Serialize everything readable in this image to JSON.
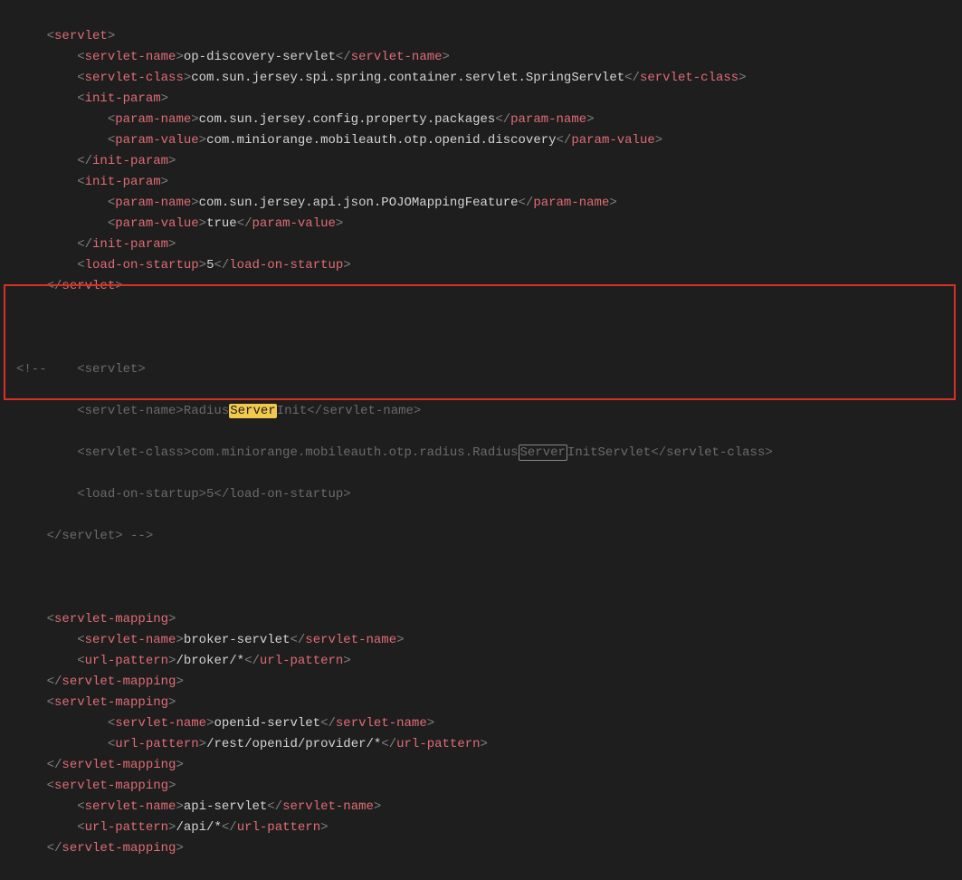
{
  "code": {
    "lines": [
      {
        "indent": 2,
        "open": "servlet"
      },
      {
        "indent": 4,
        "open": "servlet-name",
        "text": "op-discovery-servlet",
        "close": "servlet-name"
      },
      {
        "indent": 4,
        "open": "servlet-class",
        "text": "com.sun.jersey.spi.spring.container.servlet.SpringServlet",
        "close": "servlet-class"
      },
      {
        "indent": 4,
        "open": "init-param"
      },
      {
        "indent": 6,
        "open": "param-name",
        "text": "com.sun.jersey.config.property.packages",
        "close": "param-name"
      },
      {
        "indent": 6,
        "open": "param-value",
        "text": "com.miniorange.mobileauth.otp.openid.discovery",
        "close": "param-value"
      },
      {
        "indent": 4,
        "closeTag": "init-param"
      },
      {
        "indent": 4,
        "open": "init-param"
      },
      {
        "indent": 6,
        "open": "param-name",
        "text": "com.sun.jersey.api.json.POJOMappingFeature",
        "close": "param-name"
      },
      {
        "indent": 6,
        "open": "param-value",
        "text": "true",
        "close": "param-value"
      },
      {
        "indent": 4,
        "closeTag": "init-param"
      },
      {
        "indent": 4,
        "open": "load-on-startup",
        "text": "5",
        "close": "load-on-startup"
      },
      {
        "indent": 2,
        "closeTag": "servlet"
      }
    ],
    "comment": {
      "l1_pre": "<!--    <servlet>",
      "l2_pre": "        <servlet-name>Radius",
      "l2_hit": "Server",
      "l2_post": "Init</servlet-name>",
      "l3_pre": "        <servlet-class>com.miniorange.mobileauth.otp.radius.Radius",
      "l3_match": "Server",
      "l3_post": "InitServlet</servlet-class>",
      "l4": "        <load-on-startup>5</load-on-startup>",
      "l5": "    </servlet> -->"
    },
    "lines2": [
      {
        "indent": 2,
        "open": "servlet-mapping"
      },
      {
        "indent": 4,
        "open": "servlet-name",
        "text": "broker-servlet",
        "close": "servlet-name"
      },
      {
        "indent": 4,
        "open": "url-pattern",
        "text": "/broker/*",
        "close": "url-pattern"
      },
      {
        "indent": 2,
        "closeTag": "servlet-mapping"
      },
      {
        "indent": 2,
        "open": "servlet-mapping"
      },
      {
        "indent": 6,
        "open": "servlet-name",
        "text": "openid-servlet",
        "close": "servlet-name"
      },
      {
        "indent": 6,
        "open": "url-pattern",
        "text": "/rest/openid/provider/*",
        "close": "url-pattern"
      },
      {
        "indent": 2,
        "closeTag": "servlet-mapping"
      },
      {
        "indent": 2,
        "open": "servlet-mapping"
      },
      {
        "indent": 4,
        "open": "servlet-name",
        "text": "api-servlet",
        "close": "servlet-name"
      },
      {
        "indent": 4,
        "open": "url-pattern",
        "text": "/api/*",
        "close": "url-pattern"
      },
      {
        "indent": 2,
        "closeTag": "servlet-mapping"
      }
    ]
  }
}
